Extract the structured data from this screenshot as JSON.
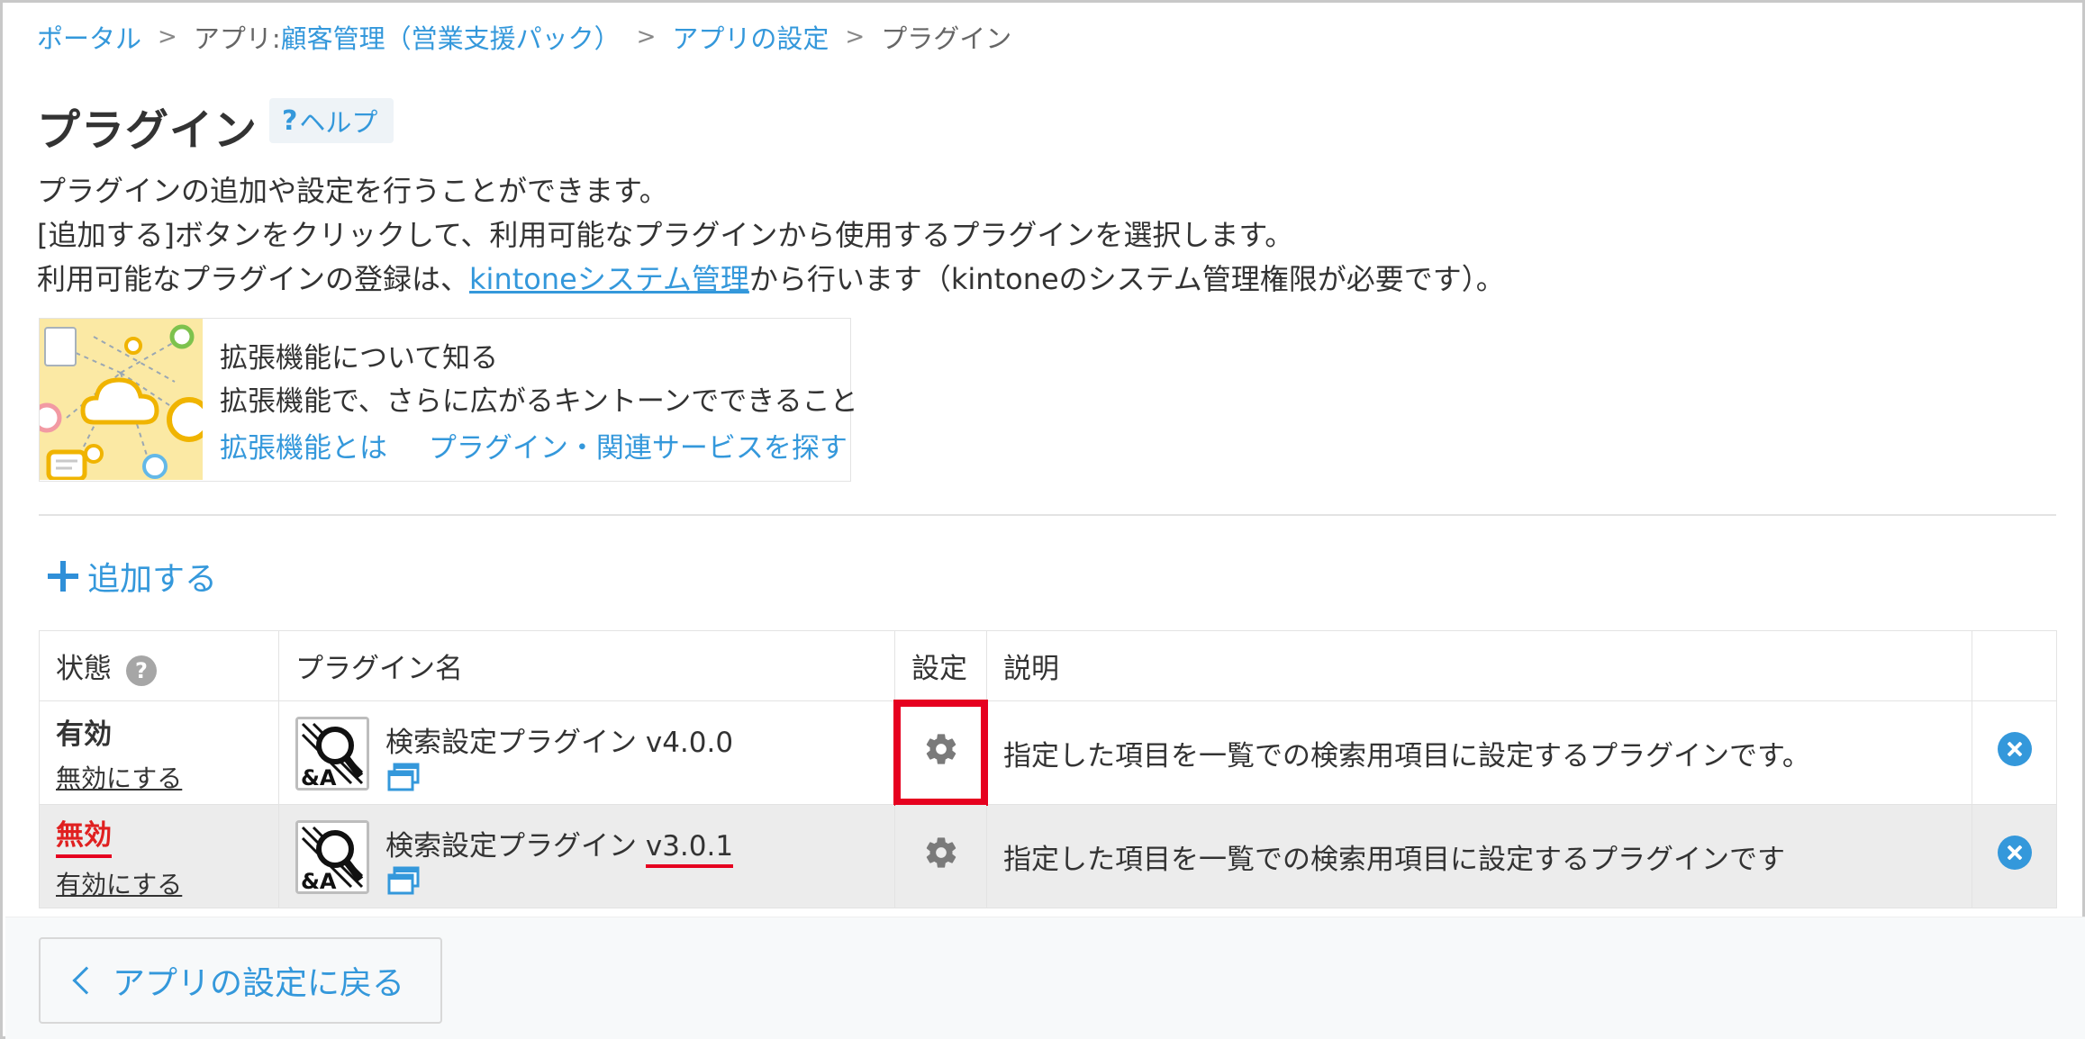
{
  "breadcrumb": {
    "portal": "ポータル",
    "app_prefix": "アプリ: ",
    "app_name": "顧客管理（営業支援パック）",
    "app_settings": "アプリの設定",
    "current": "プラグイン",
    "separator": ">"
  },
  "header": {
    "title": "プラグイン",
    "help_mark": "?",
    "help_label": "ヘルプ"
  },
  "description": {
    "line1": "プラグインの追加や設定を行うことができます。",
    "line2": "[追加する]ボタンをクリックして、利用可能なプラグインから使用するプラグインを選択します。",
    "line3_before": "利用可能なプラグインの登録は、",
    "line3_link": "kintoneシステム管理",
    "line3_after": "から行います（kintoneのシステム管理権限が必要です）。"
  },
  "extension_card": {
    "title": "拡張機能について知る",
    "subtitle": "拡張機能で、さらに広がるキントーンでできること",
    "link1": "拡張機能とは",
    "link2": "プラグイン・関連サービスを探す"
  },
  "add_button": {
    "label": "追加する"
  },
  "table": {
    "headers": {
      "status": "状態",
      "status_help": "?",
      "name": "プラグイン名",
      "settings": "設定",
      "description": "説明"
    },
    "rows": [
      {
        "status": "有効",
        "toggle": "無効にする",
        "name": "検索設定プラグイン ",
        "version": "v4.0.0",
        "description": "指定した項目を一覧での検索用項目に設定するプラグインです。"
      },
      {
        "status": "無効",
        "toggle": "有効にする",
        "name": "検索設定プラグイン ",
        "version": "v3.0.1",
        "description": "指定した項目を一覧での検索用項目に設定するプラグインです"
      }
    ]
  },
  "footer": {
    "back_label": "アプリの設定に戻る"
  },
  "colors": {
    "link": "#3498db",
    "text": "#333333",
    "highlight": "#e6001f",
    "disabled_row": "#ececec"
  },
  "icons": [
    "help-icon",
    "plus-icon",
    "question-icon",
    "plugin-logo-icon",
    "open-window-icon",
    "gear-icon",
    "close-icon",
    "chevron-left-icon"
  ]
}
